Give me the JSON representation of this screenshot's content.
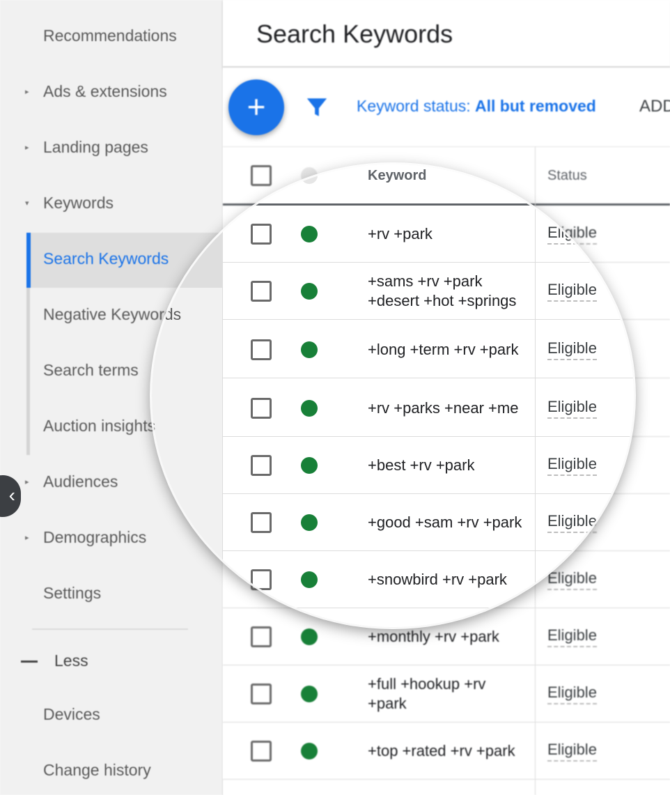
{
  "sidebar": {
    "items": [
      {
        "label": "Recommendations",
        "caret": ""
      },
      {
        "label": "Ads & extensions",
        "caret": "▸"
      },
      {
        "label": "Landing pages",
        "caret": "▸"
      },
      {
        "label": "Keywords",
        "caret": "▾"
      },
      {
        "label": "Search Keywords",
        "caret": ""
      },
      {
        "label": "Negative Keywords",
        "caret": ""
      },
      {
        "label": "Search terms",
        "caret": ""
      },
      {
        "label": "Auction insights",
        "caret": ""
      },
      {
        "label": "Audiences",
        "caret": "▸"
      },
      {
        "label": "Demographics",
        "caret": "▸"
      },
      {
        "label": "Settings",
        "caret": ""
      }
    ],
    "less_label": "Less",
    "extra_items": [
      {
        "label": "Devices"
      },
      {
        "label": "Change history"
      }
    ],
    "collapse_icon": "chevron-left-icon"
  },
  "header": {
    "title": "Search Keywords"
  },
  "toolbar": {
    "add_icon": "+",
    "filter_prefix": "Keyword status: ",
    "filter_value": "All but removed",
    "add_label": "ADD"
  },
  "table": {
    "columns": [
      "Keyword",
      "Status"
    ],
    "rows": [
      {
        "keyword": "+rv +park",
        "status": "Eligible"
      },
      {
        "keyword": "+sams +rv +park +desert +hot +springs",
        "status": "Eligible"
      },
      {
        "keyword": "+long +term +rv +park",
        "status": "Eligible"
      },
      {
        "keyword": "+rv +parks +near +me",
        "status": "Eligible"
      },
      {
        "keyword": "+best +rv +park",
        "status": "Eligible"
      },
      {
        "keyword": "+good +sam +rv +park",
        "status": "Eligible"
      },
      {
        "keyword": "+snowbird +rv +park",
        "status": "Eligible"
      },
      {
        "keyword": "+monthly +rv +park",
        "status": "Eligible"
      },
      {
        "keyword": "+full +hookup +rv +park",
        "status": "Eligible"
      },
      {
        "keyword": "+top +rated +rv +park",
        "status": "Eligible"
      }
    ]
  },
  "colors": {
    "accent": "#1a73e8",
    "status_enabled": "#188038"
  }
}
